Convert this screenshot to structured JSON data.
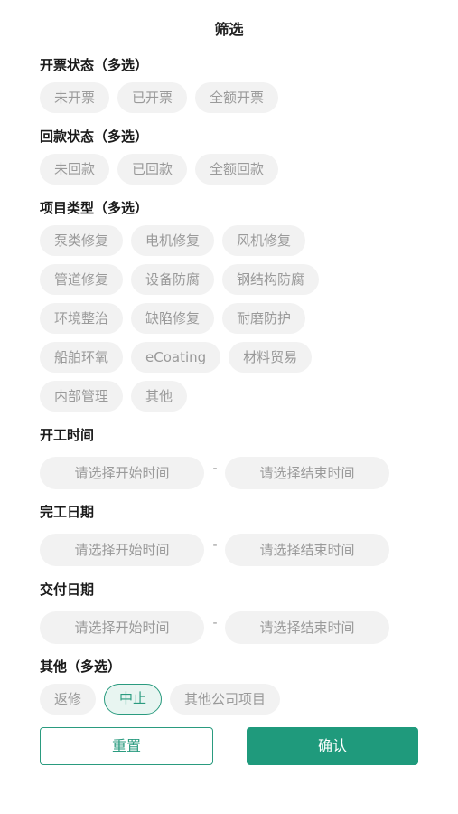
{
  "title": "筛选",
  "invoice_status": {
    "label": "开票状态（多选）",
    "options": [
      "未开票",
      "已开票",
      "全额开票"
    ]
  },
  "payment_status": {
    "label": "回款状态（多选）",
    "options": [
      "未回款",
      "已回款",
      "全额回款"
    ]
  },
  "project_type": {
    "label": "项目类型（多选）",
    "options": [
      "泵类修复",
      "电机修复",
      "风机修复",
      "管道修复",
      "设备防腐",
      "钢结构防腐",
      "环境整治",
      "缺陷修复",
      "耐磨防护",
      "船舶环氧",
      "eCoating",
      "材料贸易",
      "内部管理",
      "其他"
    ]
  },
  "start_date": {
    "label": "开工时间",
    "start_placeholder": "请选择开始时间",
    "separator": "-",
    "end_placeholder": "请选择结束时间"
  },
  "complete_date": {
    "label": "完工日期",
    "start_placeholder": "请选择开始时间",
    "separator": "-",
    "end_placeholder": "请选择结束时间"
  },
  "delivery_date": {
    "label": "交付日期",
    "start_placeholder": "请选择开始时间",
    "separator": "-",
    "end_placeholder": "请选择结束时间"
  },
  "other": {
    "label": "其他（多选）",
    "options": [
      "返修",
      "中止",
      "其他公司项目"
    ],
    "selected": "中止"
  },
  "buttons": {
    "reset": "重置",
    "confirm": "确认"
  },
  "colors": {
    "accent": "#1f9a7c",
    "chip_bg": "#f2f2f2",
    "chip_text": "#9a9a9a"
  }
}
